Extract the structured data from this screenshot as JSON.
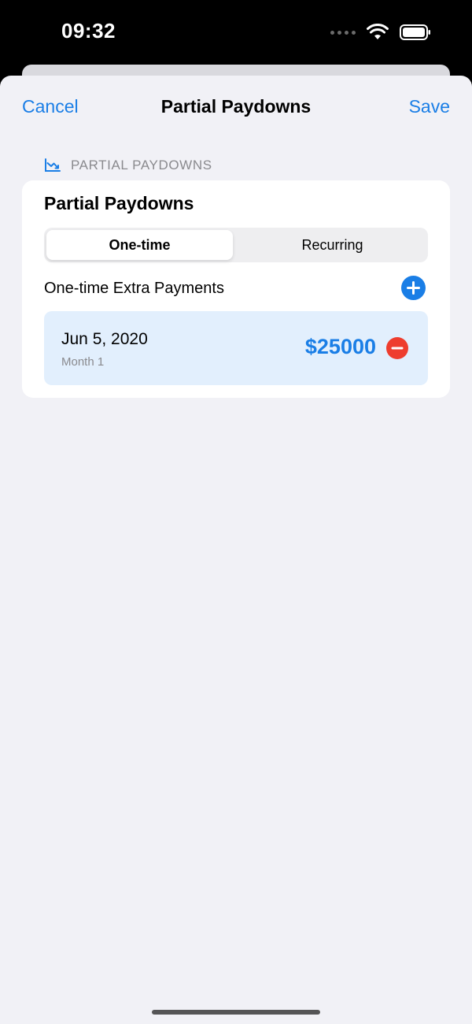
{
  "status_bar": {
    "time": "09:32"
  },
  "nav": {
    "cancel_label": "Cancel",
    "title": "Partial Paydowns",
    "save_label": "Save"
  },
  "section": {
    "header": "PARTIAL PAYDOWNS",
    "icon": "chart-line-downtrend-icon"
  },
  "card": {
    "title": "Partial Paydowns",
    "segments": [
      {
        "label": "One-time",
        "selected": true
      },
      {
        "label": "Recurring",
        "selected": false
      }
    ],
    "list_header": "One-time Extra Payments",
    "payments": [
      {
        "date": "Jun 5, 2020",
        "month": "Month 1",
        "amount": "$25000"
      }
    ]
  },
  "colors": {
    "accent": "#1a7ee6",
    "destructive": "#ee3d2e",
    "background": "#f1f1f6",
    "row_highlight": "#e2effd"
  }
}
